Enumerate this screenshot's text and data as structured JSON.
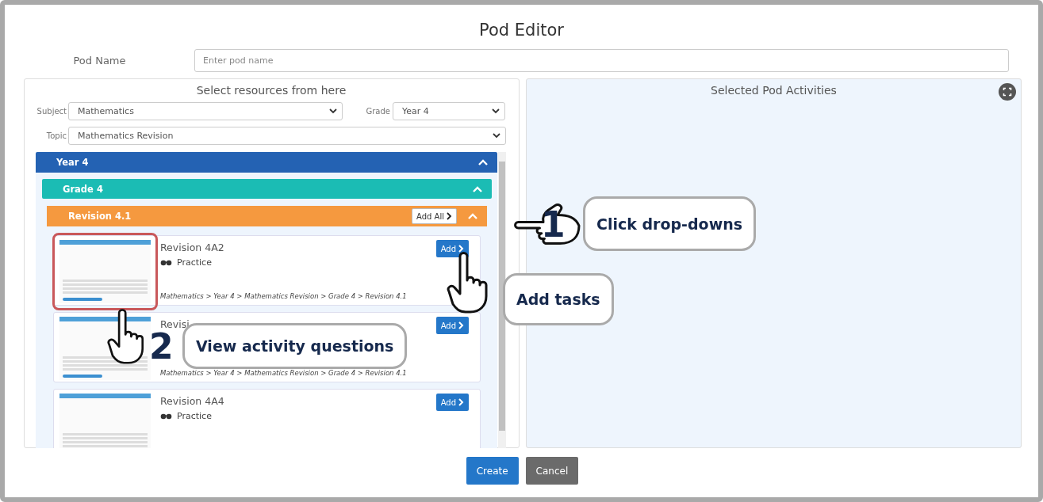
{
  "window": {
    "title": "Pod Editor"
  },
  "pod_name": {
    "label": "Pod Name",
    "placeholder": "Enter pod name"
  },
  "resources": {
    "title": "Select resources from here",
    "filters": [
      {
        "label": "Subject",
        "value": "Mathematics"
      },
      {
        "label": "Grade",
        "value": "Year 4"
      },
      {
        "label": "Topic",
        "value": "Mathematics Revision"
      }
    ],
    "tree": {
      "label": "Year 4",
      "expanded": true,
      "children": [
        {
          "label": "Grade 4",
          "expanded": true,
          "children": [
            {
              "label": "Revision 4.1",
              "expanded": true,
              "add_all": "Add All",
              "activities": [
                {
                  "title": "Revision 4A2",
                  "type": "Practice",
                  "path": "Mathematics > Year 4 > Mathematics Revision > Grade 4 > Revision 4.1",
                  "add": "Add",
                  "highlighted": true
                },
                {
                  "title": "Revisi",
                  "path": "Mathematics > Year 4 > Mathematics Revision > Grade 4 > Revision 4.1",
                  "add": "Add",
                  "highlighted": false
                },
                {
                  "title": "Revision 4A4",
                  "type": "Practice",
                  "add": "Add",
                  "highlighted": false
                }
              ]
            }
          ]
        }
      ]
    }
  },
  "selected": {
    "title": "Selected Pod Activities"
  },
  "buttons": [
    {
      "label": "Create",
      "kind": "primary"
    },
    {
      "label": "Cancel",
      "kind": "secondary"
    }
  ],
  "annotations": [
    {
      "kind": "point-left",
      "number": "1",
      "text": "Click drop-downs"
    },
    {
      "kind": "point-up",
      "text": "Add tasks"
    },
    {
      "kind": "point-up",
      "number": "2",
      "text": "View activity questions"
    }
  ]
}
